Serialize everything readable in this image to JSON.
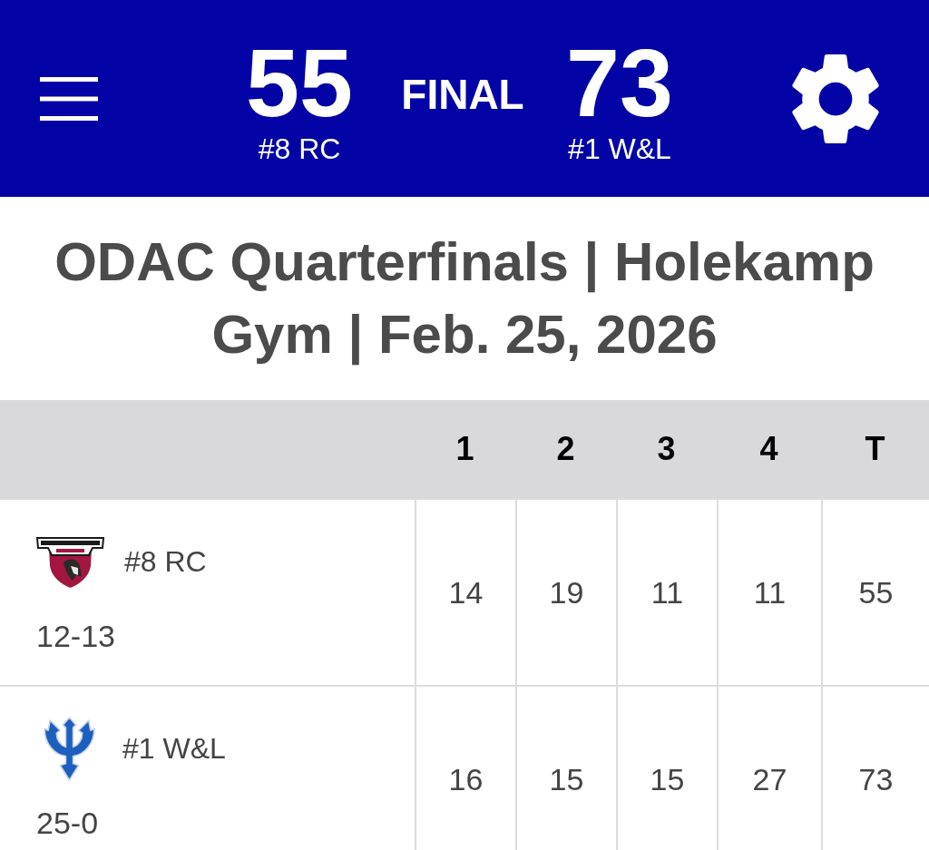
{
  "scoreboard": {
    "teams": [
      {
        "score": "55",
        "label": "#8 RC"
      },
      {
        "score": "73",
        "label": "#1 W&L"
      }
    ],
    "status": "FINAL"
  },
  "title": "ODAC Quarterfinals | Holekamp Gym | Feb. 25, 2026",
  "table": {
    "columns": [
      "1",
      "2",
      "3",
      "4",
      "T"
    ],
    "rows": [
      {
        "team": "#8 RC",
        "record": "12-13",
        "logo": {
          "kind": "shield"
        },
        "scores": [
          "14",
          "19",
          "11",
          "11",
          "55"
        ]
      },
      {
        "team": "#1 W&L",
        "record": "25-0",
        "logo": {
          "kind": "trident"
        },
        "scores": [
          "16",
          "15",
          "15",
          "27",
          "73"
        ]
      }
    ]
  }
}
